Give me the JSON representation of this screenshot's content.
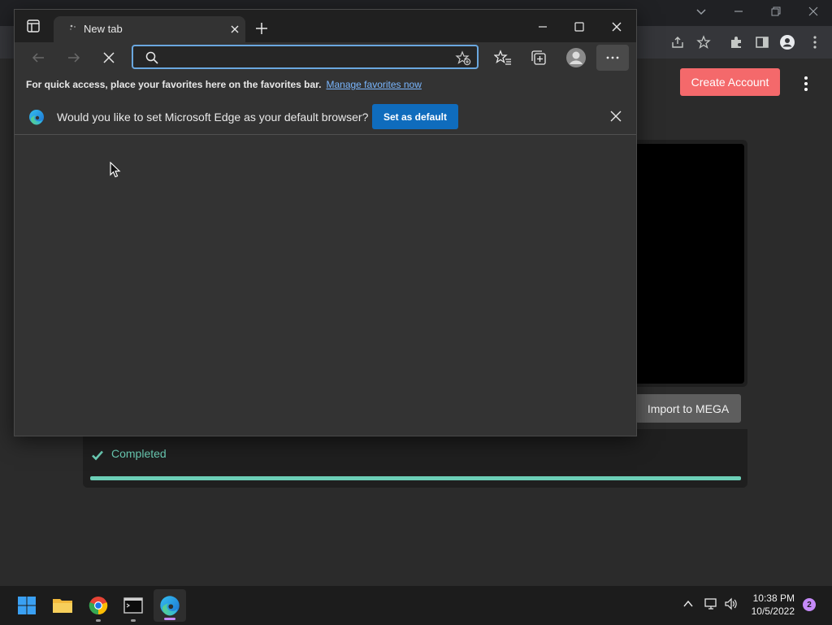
{
  "background_page": {
    "create_account_label": "Create Account",
    "import_button_label": "Import to MEGA",
    "status_label": "Completed",
    "progress_fraction": 1.0,
    "accent_color": "#6ccfb7",
    "create_account_color": "#f4696b"
  },
  "edge": {
    "tab_title": "New tab",
    "address_value": "",
    "favorites_bar_message": "For quick access, place your favorites here on the favorites bar.",
    "favorites_bar_link": "Manage favorites now",
    "infobar_message": "Would you like to set Microsoft Edge as your default browser?",
    "set_default_label": "Set as default",
    "accent_color": "#0f6cbd"
  },
  "taskbar": {
    "apps": [
      "start-icon",
      "file-explorer-icon",
      "chrome-icon",
      "terminal-icon",
      "edge-icon"
    ],
    "time": "10:38 PM",
    "date": "10/5/2022",
    "notification_count": "2"
  }
}
